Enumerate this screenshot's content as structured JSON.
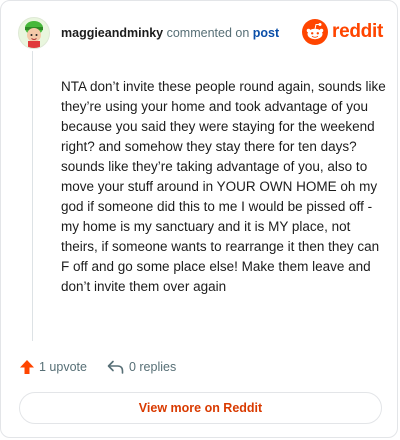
{
  "header": {
    "username": "maggieandminky",
    "action": "commented on",
    "post_link": "post"
  },
  "brand": {
    "logo_text": "reddit",
    "color": "#ff4500"
  },
  "comment": {
    "body": "NTA don’t invite these people round again, sounds like they’re using your home and took advantage of you because you said they were staying for the weekend right? and somehow they stay there for ten days? sounds like they’re taking advantage of you, also to move your stuff around in YOUR OWN HOME oh my god if someone did this to me I would be pissed off - my home is my sanctuary and it is MY place, not theirs, if someone wants to rearrange it then they can F off and go some place else! Make them leave and don’t invite them over again"
  },
  "footer": {
    "upvote_label": "1 upvote",
    "replies_label": "0 replies",
    "view_more_label": "View more on Reddit"
  }
}
